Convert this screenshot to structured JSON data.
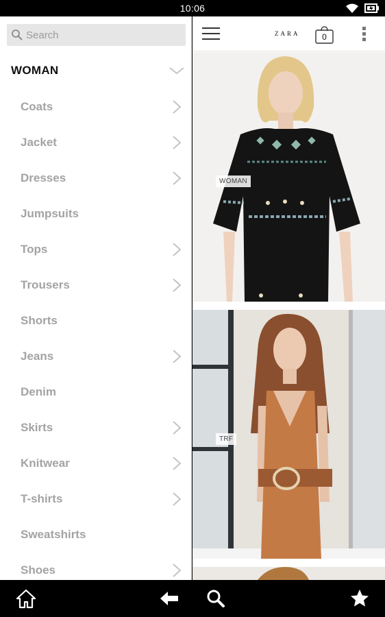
{
  "status_bar": {
    "time": "10:06"
  },
  "search": {
    "placeholder": "Search"
  },
  "drawer": {
    "section_title": "WOMAN",
    "items": [
      {
        "label": "Coats",
        "has_chevron": true
      },
      {
        "label": "Jacket",
        "has_chevron": true
      },
      {
        "label": "Dresses",
        "has_chevron": true
      },
      {
        "label": "Jumpsuits",
        "has_chevron": false
      },
      {
        "label": "Tops",
        "has_chevron": true
      },
      {
        "label": "Trousers",
        "has_chevron": true
      },
      {
        "label": "Shorts",
        "has_chevron": false
      },
      {
        "label": "Jeans",
        "has_chevron": true
      },
      {
        "label": "Denim",
        "has_chevron": false
      },
      {
        "label": "Skirts",
        "has_chevron": true
      },
      {
        "label": "Knitwear",
        "has_chevron": true
      },
      {
        "label": "T-shirts",
        "has_chevron": true
      },
      {
        "label": "Sweatshirts",
        "has_chevron": false
      },
      {
        "label": "Shoes",
        "has_chevron": true
      }
    ]
  },
  "header": {
    "brand": "ZARA",
    "bag_count": "0"
  },
  "feed": {
    "cards": [
      {
        "tag": "WOMAN"
      },
      {
        "tag": "TRF"
      }
    ]
  },
  "icons": {
    "status": [
      "wifi-icon",
      "battery-icon"
    ],
    "bottom_nav": [
      "home-icon",
      "back-icon",
      "search-icon",
      "star-icon"
    ]
  },
  "colors": {
    "menu_text": "#a3a3a3",
    "bar_bg": "#000000",
    "search_bg": "#e6e6e6"
  }
}
